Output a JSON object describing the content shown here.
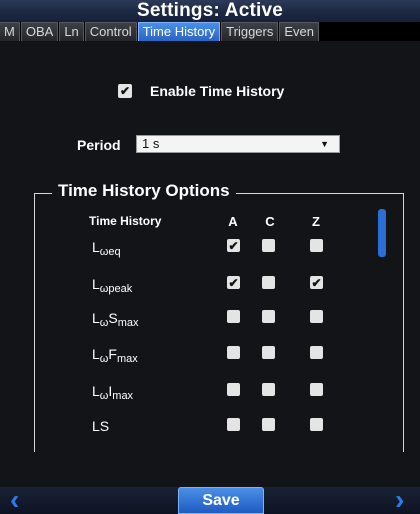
{
  "window": {
    "title": "Settings: Active"
  },
  "tabs": [
    {
      "label": "M"
    },
    {
      "label": "OBA"
    },
    {
      "label": "Ln"
    },
    {
      "label": "Control"
    },
    {
      "label": "Time History"
    },
    {
      "label": "Triggers"
    },
    {
      "label": "Even"
    }
  ],
  "active_tab": "Time History",
  "enable": {
    "label": "Enable Time History",
    "checked": true
  },
  "period": {
    "label": "Period",
    "value": "1 s"
  },
  "options_group": {
    "title": "Time History Options",
    "header": "Time History",
    "columns": [
      "A",
      "C",
      "Z"
    ],
    "rows": [
      {
        "base": "L",
        "sub": "ωeq",
        "mid": "",
        "sub2": "",
        "a": true,
        "c": false,
        "z": false
      },
      {
        "base": "L",
        "sub": "ωpeak",
        "mid": "",
        "sub2": "",
        "a": true,
        "c": false,
        "z": true
      },
      {
        "base": "L",
        "sub": "ω",
        "mid": "S",
        "sub2": "max",
        "a": false,
        "c": false,
        "z": false
      },
      {
        "base": "L",
        "sub": "ω",
        "mid": "F",
        "sub2": "max",
        "a": false,
        "c": false,
        "z": false
      },
      {
        "base": "L",
        "sub": "ω",
        "mid": "I",
        "sub2": "max",
        "a": false,
        "c": false,
        "z": false
      },
      {
        "base": "L",
        "sub": "",
        "mid": "S",
        "sub2": "",
        "a": false,
        "c": false,
        "z": false
      }
    ]
  },
  "bottom": {
    "save_label": "Save"
  },
  "icons": {
    "prev": "chevron-left-icon",
    "next": "chevron-right-icon",
    "check": "✔"
  },
  "colors": {
    "accent": "#2f7be8",
    "background": "#121418",
    "tab_active": "#3d7ed8"
  }
}
